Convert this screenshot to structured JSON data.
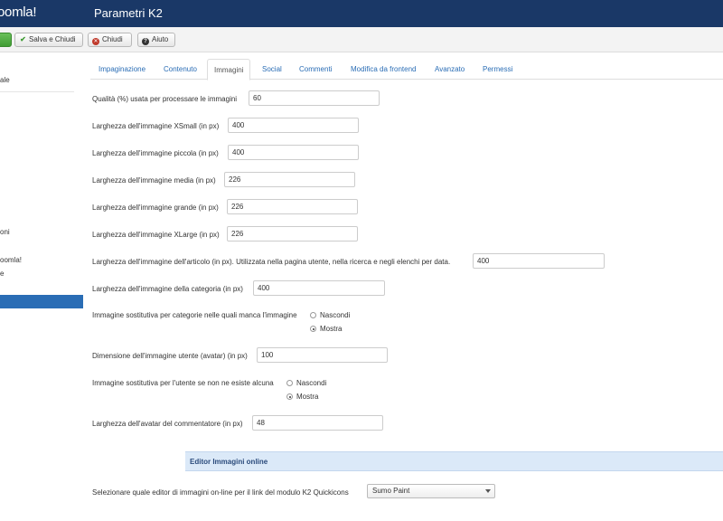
{
  "header": {
    "logo_text": "oomla!",
    "title": "Parametri K2"
  },
  "toolbar": {
    "save_close_label": "Salva e Chiudi",
    "close_label": "Chiudi",
    "help_label": "Aiuto",
    "save_icon": "check-icon",
    "close_icon": "close-circle-icon",
    "help_icon": "question-circle-icon"
  },
  "sidebar": {
    "items": [
      "ale",
      "oni",
      "oomla!",
      "e"
    ]
  },
  "tabs": [
    "Impaginazione",
    "Contenuto",
    "Immagini",
    "Social",
    "Commenti",
    "Modifica da frontend",
    "Avanzato",
    "Permessi"
  ],
  "active_tab": "Immagini",
  "fields": {
    "quality": {
      "label": "Qualità (%) usata per processare le immagini",
      "value": "60"
    },
    "xsmall": {
      "label": "Larghezza dell'immagine XSmall (in px)",
      "value": "400"
    },
    "small": {
      "label": "Larghezza dell'immagine piccola (in px)",
      "value": "400"
    },
    "medium": {
      "label": "Larghezza dell'immagine media (in px)",
      "value": "226"
    },
    "large": {
      "label": "Larghezza dell'immagine grande (in px)",
      "value": "226"
    },
    "xlarge": {
      "label": "Larghezza dell'immagine XLarge (in px)",
      "value": "226"
    },
    "article": {
      "label": "Larghezza dell'immagine dell'articolo (in px). Utilizzata nella pagina utente, nella ricerca e negli elenchi per data.",
      "value": "400"
    },
    "category": {
      "label": "Larghezza dell'immagine della categoria (in px)",
      "value": "400"
    },
    "cat_placeholder": {
      "label": "Immagine sostitutiva per categorie nelle quali manca l'immagine",
      "option_hide": "Nascondi",
      "option_show": "Mostra",
      "selected": "Mostra"
    },
    "avatar": {
      "label": "Dimensione dell'immagine utente (avatar) (in px)",
      "value": "100"
    },
    "user_placeholder": {
      "label": "Immagine sostitutiva per l'utente se non ne esiste alcuna",
      "option_hide": "Nascondi",
      "option_show": "Mostra",
      "selected": "Mostra"
    },
    "commenter_avatar": {
      "label": "Larghezza dell'avatar del commentatore (in px)",
      "value": "48"
    }
  },
  "section_title": "Editor Immagini online",
  "editor_select": {
    "label": "Selezionare quale editor di immagini on-line per il link del modulo K2 Quickicons",
    "value": "Sumo Paint"
  },
  "colors": {
    "header_bg": "#1a3867",
    "accent": "#2a6db5",
    "section_bg": "#dbe9f8"
  }
}
